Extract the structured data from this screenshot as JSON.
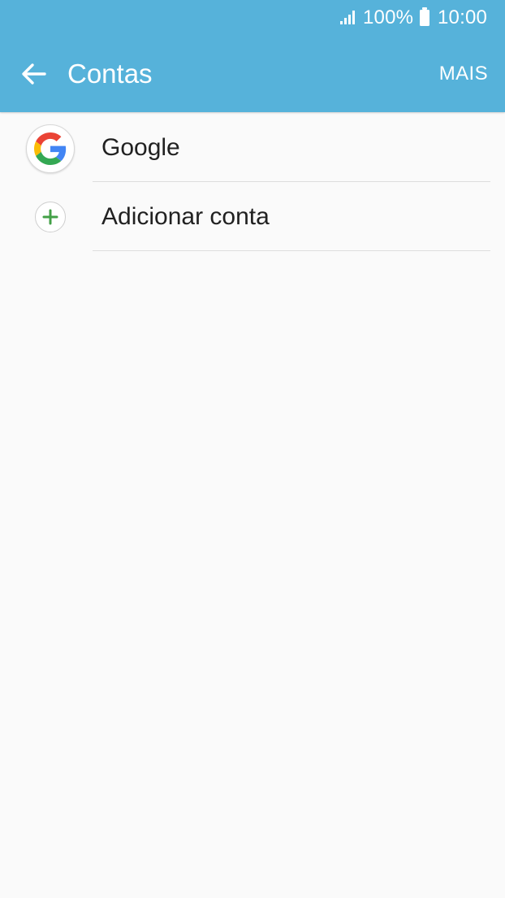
{
  "status_bar": {
    "battery_percent": "100%",
    "time": "10:00",
    "icons": {
      "signal": "signal-icon",
      "battery": "battery-icon"
    }
  },
  "header": {
    "back_icon": "arrow-left-icon",
    "title": "Contas",
    "more_label": "MAIS",
    "background_color": "#56b2da"
  },
  "accounts": {
    "items": [
      {
        "label": "Google",
        "icon": "google-icon"
      },
      {
        "label": "Adicionar conta",
        "icon": "plus-icon"
      }
    ]
  },
  "colors": {
    "content_background": "#fafafa",
    "text_primary": "#212121",
    "add_icon_green": "#43a047",
    "google_blue": "#4285f4",
    "google_red": "#ea4335",
    "google_yellow": "#fbbc05",
    "google_green": "#34a853"
  }
}
